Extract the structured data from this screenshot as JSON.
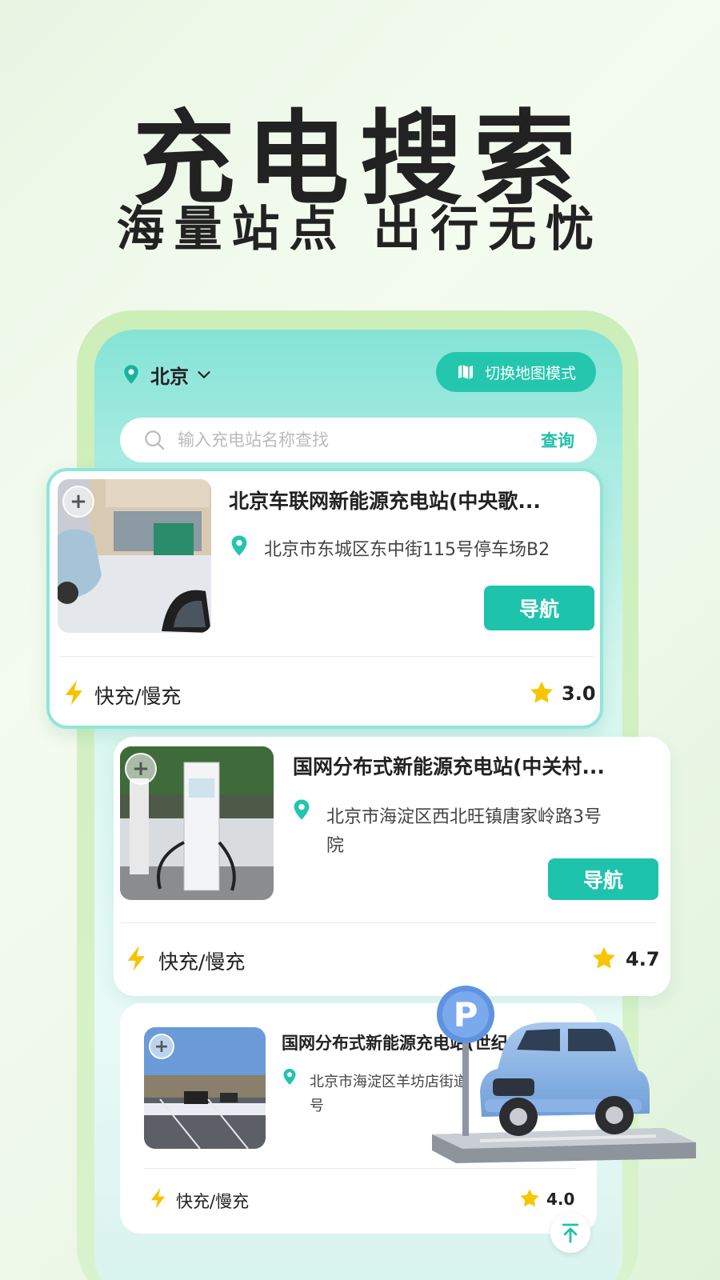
{
  "promo": {
    "headline": "充电搜索",
    "subline": "海量站点 出行无忧"
  },
  "header": {
    "city": "北京",
    "map_mode_label": "切换地图模式"
  },
  "search": {
    "placeholder": "输入充电站名称查找",
    "query_label": "查询"
  },
  "stations": [
    {
      "title": "北京车联网新能源充电站(中央歌...",
      "address": "北京市东城区东中街115号停车场B2",
      "nav_label": "导航",
      "charge_type": "快充/慢充",
      "rating": "3.0"
    },
    {
      "title": "国网分布式新能源充电站(中关村...",
      "address_line1": "北京市海淀区西北旺镇唐家岭路3号",
      "address_line2": "院",
      "nav_label": "导航",
      "charge_type": "快充/慢充",
      "rating": "4.7"
    },
    {
      "title": "国网分布式新能源充电站(世纪",
      "address_line1": "北京市海淀区羊坊店街道",
      "address_line2": "号",
      "charge_type": "快充/慢充",
      "rating": "4.0"
    }
  ],
  "colors": {
    "accent": "#1ec3ac",
    "star": "#f7c600",
    "bolt": "#f5c400"
  },
  "icons": {
    "location": "location-pin-icon",
    "chevron": "chevron-down-icon",
    "map": "map-icon",
    "search": "search-icon",
    "bolt": "lightning-bolt-icon",
    "star": "star-icon",
    "plus": "plus-icon",
    "back_to_top": "arrow-up-icon"
  }
}
